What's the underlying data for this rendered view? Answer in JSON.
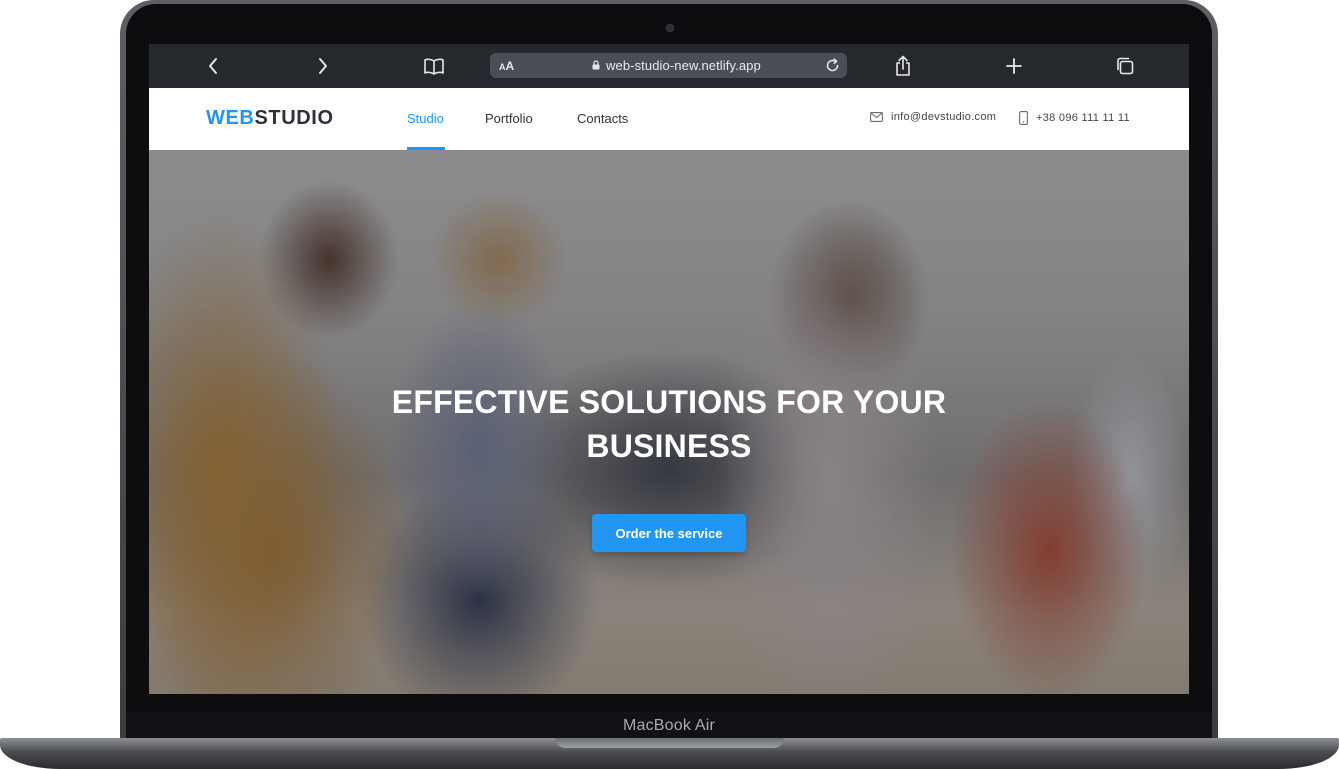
{
  "device": {
    "label": "MacBook Air"
  },
  "browser": {
    "text_size_label": "AA",
    "url": "web-studio-new.netlify.app",
    "icons": [
      "chevron-left-icon",
      "chevron-right-icon",
      "book-icon",
      "lock-icon",
      "reload-icon",
      "share-icon",
      "plus-icon",
      "tabs-icon"
    ]
  },
  "site": {
    "logo": {
      "accent": "WEB",
      "rest": "STUDIO"
    },
    "nav": [
      {
        "label": "Studio",
        "active": true
      },
      {
        "label": "Portfolio",
        "active": false
      },
      {
        "label": "Contacts",
        "active": false
      }
    ],
    "contacts": {
      "email": "info@devstudio.com",
      "phone": "+38 096 111 11 11"
    },
    "hero": {
      "title": "EFFECTIVE SOLUTIONS FOR YOUR BUSINESS",
      "cta_label": "Order the service"
    }
  },
  "colors": {
    "accent": "#2196f3",
    "text_dark": "#2f303a",
    "browser_bar": "#25292e"
  }
}
